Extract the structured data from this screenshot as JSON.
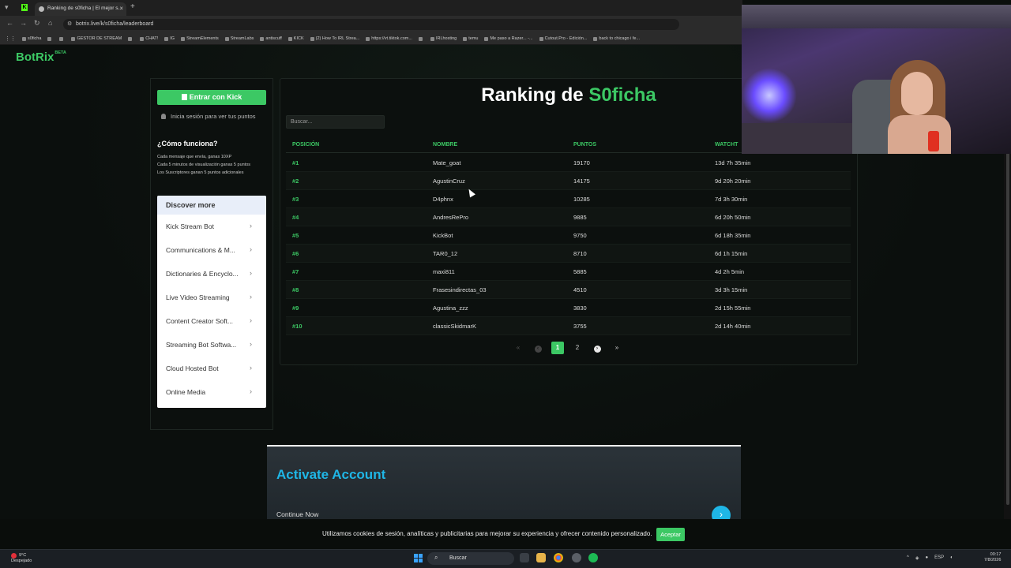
{
  "browser": {
    "tab_title": "Ranking de s0ficha | El mejor s...",
    "url": "botrix.live/k/s0ficha/leaderboard",
    "bookmarks": [
      "s0ficha",
      "",
      "",
      "GESTOR DE STREAM",
      "",
      "CHAT!",
      "IG",
      "StreamElements",
      "StreamLabs",
      "antiscuff",
      "KICK",
      "(2) How To IRL Strea...",
      "https://vt.tiktok.com...",
      "",
      "IRLhosting",
      "temu",
      "Me paso a Razer... -...",
      "Cutout.Pro - Edición...",
      "back to chicago i fe..."
    ]
  },
  "site": {
    "logo": "BotRix",
    "logo_badge": "BETA"
  },
  "sidebar": {
    "kick_button": "Entrar con Kick",
    "login_hint": "Inicia sesión para ver tus puntos",
    "how_title": "¿Cómo funciona?",
    "how_lines": [
      "Cada mensaje que envía, ganas 10XP",
      "Cada 5 minutos de visualización ganas 5 puntos",
      "Los Suscriptores ganan 5 puntos adicionales"
    ],
    "discover_title": "Discover more",
    "discover_items": [
      "Kick Stream Bot",
      "Communications & M...",
      "Dictionaries & Encyclo...",
      "Live Video Streaming",
      "Content Creator Soft...",
      "Streaming Bot Softwa...",
      "Cloud Hosted Bot",
      "Online Media"
    ]
  },
  "leaderboard": {
    "title_prefix": "Ranking de",
    "title_name": "S0ficha",
    "search_placeholder": "Buscar...",
    "columns": [
      "POSICIÓN",
      "NOMBRE",
      "PUNTOS",
      "WATCHT"
    ],
    "rows": [
      {
        "pos": "#1",
        "name": "Mate_goat",
        "points": "19170",
        "watch": "13d 7h 35min"
      },
      {
        "pos": "#2",
        "name": "AgustinCruz",
        "points": "14175",
        "watch": "9d 20h 20min"
      },
      {
        "pos": "#3",
        "name": "D4phnx",
        "points": "10285",
        "watch": "7d 3h 30min"
      },
      {
        "pos": "#4",
        "name": "AndresRePro",
        "points": "9885",
        "watch": "6d 20h 50min"
      },
      {
        "pos": "#5",
        "name": "KickBot",
        "points": "9750",
        "watch": "6d 18h 35min"
      },
      {
        "pos": "#6",
        "name": "TAR0_12",
        "points": "8710",
        "watch": "6d 1h 15min"
      },
      {
        "pos": "#7",
        "name": "maxi811",
        "points": "5885",
        "watch": "4d 2h 5min"
      },
      {
        "pos": "#8",
        "name": "Frasesindirectas_03",
        "points": "4510",
        "watch": "3d 3h 15min"
      },
      {
        "pos": "#9",
        "name": "Agustina_zzz",
        "points": "3830",
        "watch": "2d 15h 55min"
      },
      {
        "pos": "#10",
        "name": "classicSkidmarK",
        "points": "3755",
        "watch": "2d 14h 40min"
      }
    ],
    "pagination": {
      "first": "«",
      "prev": "‹",
      "pages": [
        "1",
        "2"
      ],
      "current": "1",
      "next": "›",
      "last": "»"
    }
  },
  "ad": {
    "title": "Activate Account",
    "link": "Continue Now"
  },
  "cookie": {
    "text": "Utilizamos cookies de sesión, analíticas y publicitarias para mejorar su experiencia y ofrecer contenido personalizado.",
    "accept": "Aceptar"
  },
  "taskbar": {
    "weather_temp": "9°C",
    "weather_desc": "Despejado",
    "search": "Buscar",
    "lang": "ESP",
    "time": "00:17",
    "date": "7/8/2026"
  },
  "colors": {
    "accent": "#3cc864",
    "ad_accent": "#1fb6e6"
  }
}
